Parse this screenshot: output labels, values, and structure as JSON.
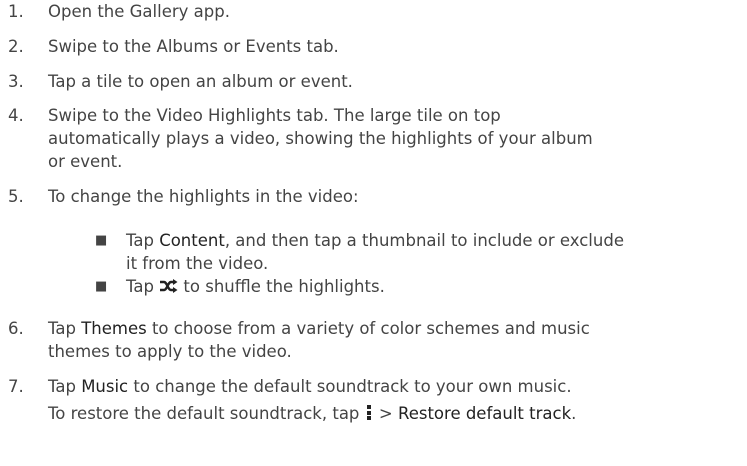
{
  "steps": [
    {
      "num": "1.",
      "text": "Open the Gallery app."
    },
    {
      "num": "2.",
      "text": "Swipe to the Albums or Events tab."
    },
    {
      "num": "3.",
      "text": "Tap a tile to open an album or event."
    },
    {
      "num": "4.",
      "line1": "Swipe to the Video Highlights tab. The large tile on top",
      "line2": "automatically plays a video, showing the highlights of your album",
      "line3": "or event."
    },
    {
      "num": "5.",
      "text": "To change the highlights in the video:"
    },
    {
      "num": "6.",
      "pre": "Tap ",
      "highlight": "Themes",
      "post": " to choose from a variety of color schemes and music",
      "line2": "themes to apply to the video."
    },
    {
      "num": "7.",
      "pre": "Tap ",
      "highlight": "Music",
      "post": " to change the default soundtrack to your own music."
    }
  ],
  "bullets": [
    {
      "pre": "Tap ",
      "highlight": "Content",
      "post": ", and then tap a thumbnail to include or exclude",
      "line2": "it from the video."
    },
    {
      "pre": "Tap ",
      "icon": "shuffle-icon",
      "post": " to shuffle the highlights."
    }
  ],
  "note": {
    "pre": "To restore the default soundtrack, tap ",
    "icon": "menu-icon",
    "mid": " > ",
    "highlight": "Restore default track",
    "post": "."
  },
  "bullet_glyph": "■"
}
